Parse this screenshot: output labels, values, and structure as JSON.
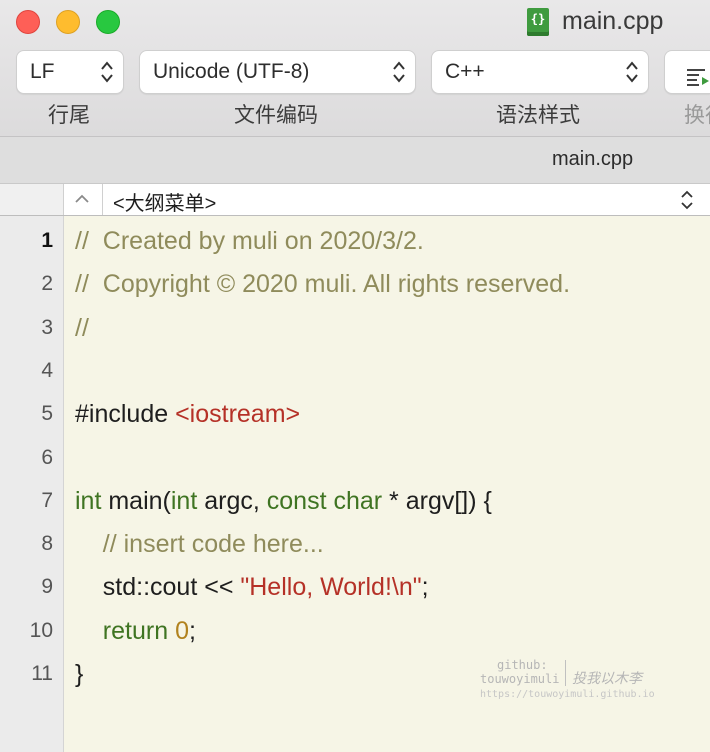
{
  "window": {
    "title": "main.cpp",
    "doc_icon_glyph": "{}"
  },
  "toolbar": {
    "line_ending": {
      "value": "LF",
      "label": "行尾"
    },
    "encoding": {
      "value": "Unicode (UTF-8)",
      "label": "文件编码"
    },
    "syntax": {
      "value": "C++",
      "label": "语法样式"
    },
    "wrap": {
      "label": "换行"
    }
  },
  "tab": {
    "title": "main.cpp"
  },
  "navigator": {
    "menu": "<大纲菜单>"
  },
  "editor": {
    "current_line": 1,
    "line_numbers": [
      "1",
      "2",
      "3",
      "4",
      "5",
      "6",
      "7",
      "8",
      "9",
      "10",
      "11"
    ],
    "lines": [
      [
        {
          "t": "//  Created by muli on 2020/3/2.",
          "c": "comment"
        }
      ],
      [
        {
          "t": "//  Copyright © 2020 muli. All rights reserved.",
          "c": "comment"
        }
      ],
      [
        {
          "t": "//",
          "c": "comment"
        }
      ],
      [],
      [
        {
          "t": "#include ",
          "c": "plain"
        },
        {
          "t": "<iostream>",
          "c": "string"
        }
      ],
      [],
      [
        {
          "t": "int",
          "c": "keyword"
        },
        {
          "t": " main(",
          "c": "plain"
        },
        {
          "t": "int",
          "c": "keyword"
        },
        {
          "t": " argc, ",
          "c": "plain"
        },
        {
          "t": "const char",
          "c": "keyword"
        },
        {
          "t": " * argv[]) {",
          "c": "plain"
        }
      ],
      [
        {
          "t": "    // insert code here...",
          "c": "comment"
        }
      ],
      [
        {
          "t": "    std::cout << ",
          "c": "plain"
        },
        {
          "t": "\"Hello, World!\\n\"",
          "c": "string"
        },
        {
          "t": ";",
          "c": "plain"
        }
      ],
      [
        {
          "t": "    ",
          "c": "plain"
        },
        {
          "t": "return",
          "c": "keyword"
        },
        {
          "t": " ",
          "c": "plain"
        },
        {
          "t": "0",
          "c": "number"
        },
        {
          "t": ";",
          "c": "plain"
        }
      ],
      [
        {
          "t": "}",
          "c": "plain"
        }
      ]
    ]
  },
  "watermark": {
    "line1": "github:",
    "line2": "touwoyimuli",
    "cn": "投我以木李",
    "url": "https://touwoyimuli.github.io"
  },
  "colors": {
    "comment": "#8f8b5b",
    "string": "#b53127",
    "keyword": "#3f7422",
    "number": "#b1821e",
    "editor_bg": "#f6f5e6"
  }
}
